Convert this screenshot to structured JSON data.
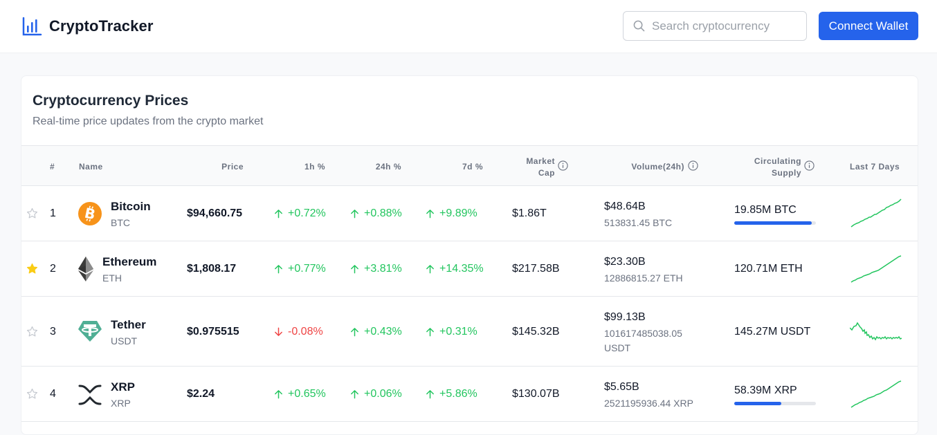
{
  "app": {
    "name": "CryptoTracker",
    "search_placeholder": "Search cryptocurrency",
    "connect_label": "Connect Wallet",
    "accent": "#2563eb"
  },
  "card": {
    "title": "Cryptocurrency Prices",
    "subtitle": "Real-time price updates from the crypto market"
  },
  "columns": {
    "rank": "#",
    "name": "Name",
    "price": "Price",
    "h1": "1h %",
    "h24": "24h %",
    "d7": "7d %",
    "mcap_line1": "Market",
    "mcap_line2": "Cap",
    "volume": "Volume(24h)",
    "supply_line1": "Circulating",
    "supply_line2": "Supply",
    "last7": "Last 7 Days"
  },
  "rows": [
    {
      "rank": "1",
      "favorite": false,
      "name": "Bitcoin",
      "symbol": "BTC",
      "icon": "bitcoin-icon",
      "price": "$94,660.75",
      "h1": "+0.72%",
      "h1_dir": "up",
      "h24": "+0.88%",
      "h24_dir": "up",
      "d7": "+9.89%",
      "d7_dir": "up",
      "mcap": "$1.86T",
      "vol_usd": "$48.64B",
      "vol_coin": "513831.45 BTC",
      "supply": "19.85M BTC",
      "supply_fraction": 0.945,
      "spark_trend": "up"
    },
    {
      "rank": "2",
      "favorite": true,
      "name": "Ethereum",
      "symbol": "ETH",
      "icon": "ethereum-icon",
      "price": "$1,808.17",
      "h1": "+0.77%",
      "h1_dir": "up",
      "h24": "+3.81%",
      "h24_dir": "up",
      "d7": "+14.35%",
      "d7_dir": "up",
      "mcap": "$217.58B",
      "vol_usd": "$23.30B",
      "vol_coin": "12886815.27 ETH",
      "supply": "120.71M ETH",
      "supply_fraction": null,
      "spark_trend": "up"
    },
    {
      "rank": "3",
      "favorite": false,
      "name": "Tether",
      "symbol": "USDT",
      "icon": "tether-icon",
      "price": "$0.975515",
      "h1": "-0.08%",
      "h1_dir": "down",
      "h24": "+0.43%",
      "h24_dir": "up",
      "d7": "+0.31%",
      "d7_dir": "up",
      "mcap": "$145.32B",
      "vol_usd": "$99.13B",
      "vol_coin": "101617485038.05 USDT",
      "supply": "145.27M USDT",
      "supply_fraction": null,
      "spark_trend": "volatile"
    },
    {
      "rank": "4",
      "favorite": false,
      "name": "XRP",
      "symbol": "XRP",
      "icon": "xrp-icon",
      "price": "$2.24",
      "h1": "+0.65%",
      "h1_dir": "up",
      "h24": "+0.06%",
      "h24_dir": "up",
      "d7": "+5.86%",
      "d7_dir": "up",
      "mcap": "$130.07B",
      "vol_usd": "$5.65B",
      "vol_coin": "2521195936.44 XRP",
      "supply": "58.39M XRP",
      "supply_fraction": 0.58,
      "spark_trend": "up"
    }
  ]
}
